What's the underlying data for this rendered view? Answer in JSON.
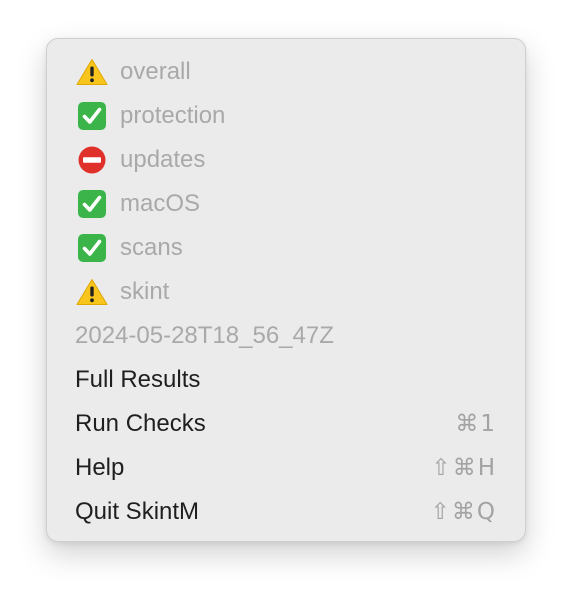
{
  "menu": {
    "status_items": [
      {
        "icon": "warning-icon",
        "label": "overall"
      },
      {
        "icon": "check-icon",
        "label": "protection"
      },
      {
        "icon": "no-entry-icon",
        "label": "updates"
      },
      {
        "icon": "check-icon",
        "label": "macOS"
      },
      {
        "icon": "check-icon",
        "label": "scans"
      },
      {
        "icon": "warning-icon",
        "label": "skint"
      }
    ],
    "timestamp": "2024-05-28T18_56_47Z",
    "actions": [
      {
        "label": "Full Results",
        "shortcut": ""
      },
      {
        "label": "Run Checks",
        "shortcut": "⌘1"
      },
      {
        "label": "Help",
        "shortcut": "⇧⌘H"
      },
      {
        "label": "Quit SkintM",
        "shortcut": "⇧⌘Q"
      }
    ]
  },
  "colors": {
    "warning": "#f7c51c",
    "check": "#3bb54a",
    "no_entry": "#e0302a",
    "disabled_text": "#a9a9a9",
    "enabled_text": "#1f1f1f",
    "menu_bg": "#ebebeb"
  }
}
